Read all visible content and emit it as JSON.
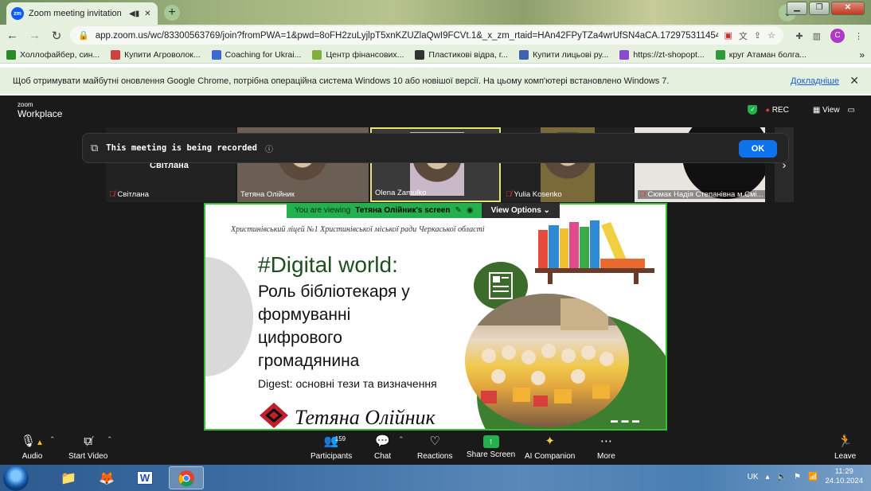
{
  "browser": {
    "tab_title": "Zoom meeting invitation - Z",
    "url": "app.zoom.us/wc/83300563769/join?fromPWA=1&pwd=8oFH2zuLyjlpT5xnKZUZlaQwI9FCVt.1&_x_zm_rtaid=HAn42FPyTZa4wrUfSN4aCA.1729753114548...",
    "profile_initial": "C",
    "new_tab_label": "+",
    "bookmarks": [
      {
        "label": "Холлофайбер, син...",
        "color": "#2a8a2a"
      },
      {
        "label": "Купити Агроволок...",
        "color": "#d04040"
      },
      {
        "label": "Coaching for Ukrai...",
        "color": "#3a6ad0"
      },
      {
        "label": "Центр фінансових...",
        "color": "#7fb03a"
      },
      {
        "label": "Пластикові відра, г...",
        "color": "#333333"
      },
      {
        "label": "Купити лицьові ру...",
        "color": "#4060b0"
      },
      {
        "label": "https://zt-shopopt...",
        "color": "#8a4ad0"
      },
      {
        "label": "круг Атаман болга...",
        "color": "#2f9a3a"
      }
    ],
    "more_bookmarks": "»"
  },
  "infobar": {
    "text": "Щоб отримувати майбутні оновлення Google Chrome, потрібна операційна система Windows 10 або новішої версії. На цьому комп'ютері встановлено Windows 7.",
    "link": "Докладніше",
    "close": "✕"
  },
  "zoom": {
    "logo_line1": "zoom",
    "logo_line2": "Workplace",
    "rec_label": "REC",
    "view_label": "View",
    "recording_banner": "This meeting is being recorded",
    "recording_ok": "OK",
    "participants": [
      {
        "name": "Світлана",
        "muted": true,
        "overlay": "Світлана"
      },
      {
        "name": "Тетяна Олійник",
        "muted": false
      },
      {
        "name": "Olena Zamulko",
        "muted": false
      },
      {
        "name": "Yulia Kosenko",
        "muted": true
      },
      {
        "name": "Сюмак Надія Степанівна м.Смі...",
        "muted": true
      }
    ],
    "viewing_prefix": "You are viewing",
    "viewing_name": "Тетяна Олійник's screen",
    "view_options": "View Options",
    "slide": {
      "school": "Христинівський ліцей №1 Христинівської міської ради Черкаської області",
      "title": "#Digital world:",
      "lines": [
        "Роль бібліотекаря у",
        "формуванні",
        "цифрового",
        "громадянина"
      ],
      "digest": "Digest: основні тези та визначення",
      "author": "Тетяна Олійник"
    },
    "footer": {
      "audio": "Audio",
      "start_video": "Start Video",
      "participants": "Participants",
      "participants_count": "159",
      "chat": "Chat",
      "reactions": "Reactions",
      "share_screen": "Share Screen",
      "ai_companion": "AI Companion",
      "more": "More",
      "leave": "Leave"
    }
  },
  "taskbar": {
    "lang": "UK",
    "time": "11:29",
    "date": "24.10.2024"
  }
}
